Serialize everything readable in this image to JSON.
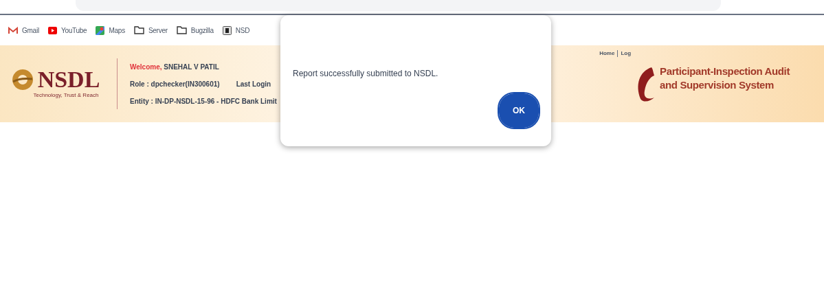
{
  "bookmarks": [
    {
      "label": "Gmail",
      "kind": "gmail"
    },
    {
      "label": "YouTube",
      "kind": "youtube"
    },
    {
      "label": "Maps",
      "kind": "maps"
    },
    {
      "label": "Server",
      "kind": "folder"
    },
    {
      "label": "Bugzilla",
      "kind": "folder"
    },
    {
      "label": "NSD",
      "kind": "page"
    }
  ],
  "header": {
    "logo": {
      "name": "NSDL",
      "tagline": "Technology, Trust & Reach"
    },
    "welcome_label": "Welcome,",
    "user": "SNEHAL V PATIL",
    "role": "Role : dpchecker(IN300601)",
    "last_login": "Last Login",
    "entity": "Entity : IN-DP-NSDL-15-96 - HDFC Bank Limit",
    "links": [
      "Home",
      "Log"
    ],
    "system_title": [
      "Participant-Inspection Audit",
      "and Supervision System"
    ]
  },
  "dialog": {
    "message": "Report successfully submitted to NSDL.",
    "button": "OK"
  }
}
